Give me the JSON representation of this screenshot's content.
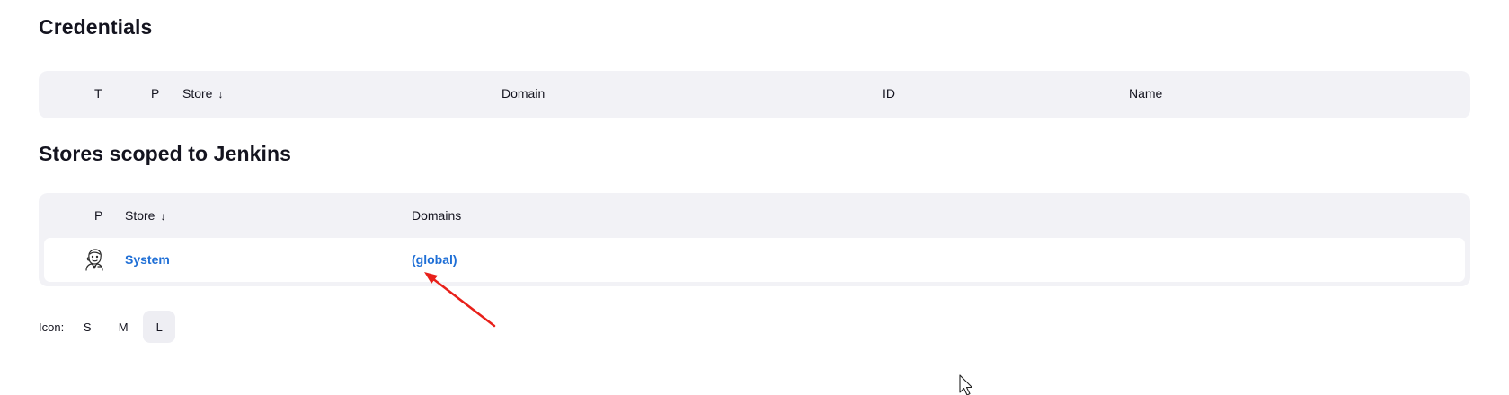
{
  "credentials": {
    "title": "Credentials",
    "columns": {
      "type": "T",
      "provider": "P",
      "store": "Store",
      "store_sort": "↓",
      "domain": "Domain",
      "id": "ID",
      "name": "Name"
    }
  },
  "stores": {
    "title": "Stores scoped to Jenkins",
    "columns": {
      "provider": "P",
      "store": "Store",
      "store_sort": "↓",
      "domains": "Domains"
    },
    "rows": [
      {
        "icon": "jenkins-butler-icon",
        "store": "System",
        "domain": "(global)"
      }
    ]
  },
  "icon_size": {
    "label": "Icon:",
    "options": [
      "S",
      "M",
      "L"
    ],
    "selected": "L"
  },
  "colors": {
    "link": "#1f6fd6",
    "panel_bg": "#f2f2f6",
    "annotation_arrow": "#e8201a"
  }
}
